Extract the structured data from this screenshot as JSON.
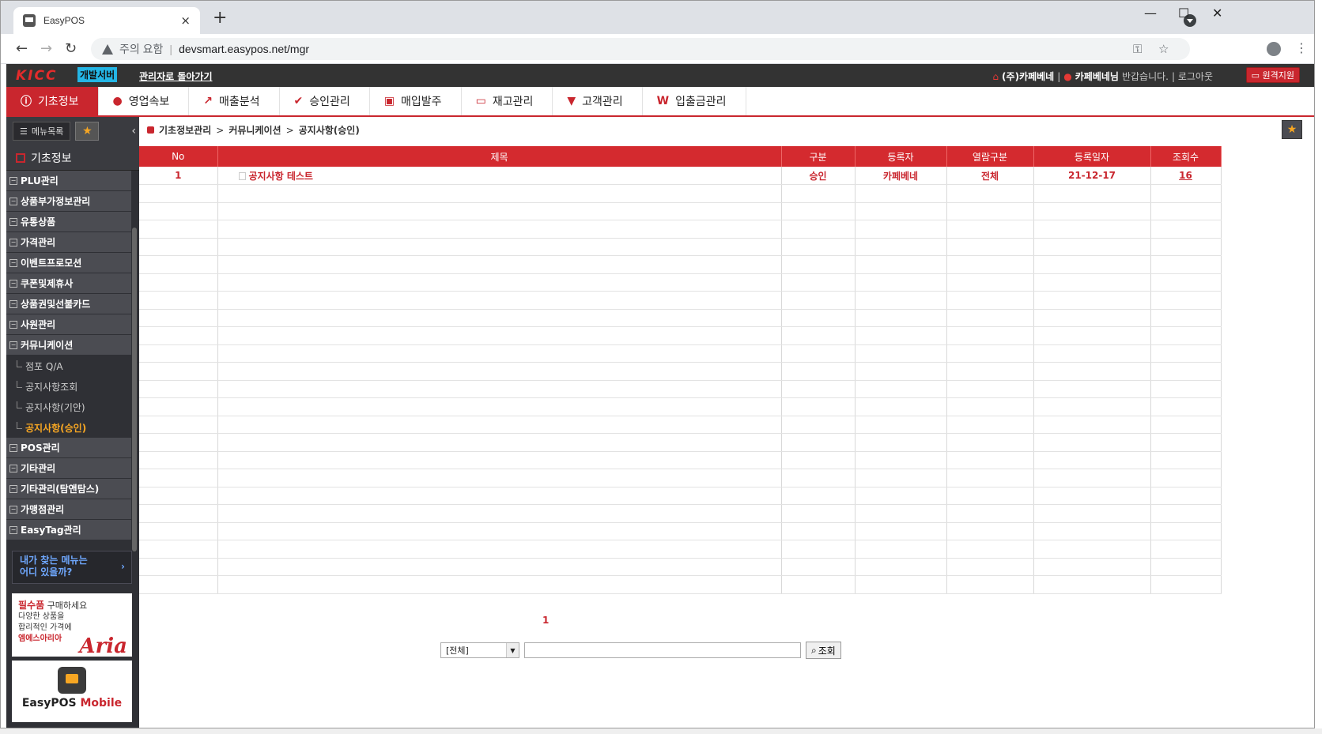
{
  "browser": {
    "tab_title": "EasyPOS",
    "tab_close": "×",
    "new_tab": "+",
    "window_controls": [
      "—",
      "☐",
      "✕"
    ],
    "security_label": "주의 요함",
    "separator": "|",
    "url": "devsmart.easypos.net/mgr"
  },
  "header": {
    "logo": "KICC",
    "dev_badge": "개발서버",
    "back_link": "관리자로 돌아가기",
    "company": "(주)카페베네",
    "divider": "|",
    "username": "카페베네님",
    "greeting": "반갑습니다.",
    "logout": "| 로그아웃",
    "remote_support": "원격지원"
  },
  "nav": {
    "items": [
      {
        "label": "기초정보",
        "icon": "info-icon",
        "glyph": "ⓘ"
      },
      {
        "label": "영업속보",
        "icon": "mic-icon",
        "glyph": "●"
      },
      {
        "label": "매출분석",
        "icon": "trend-icon",
        "glyph": "↗"
      },
      {
        "label": "승인관리",
        "icon": "check-icon",
        "glyph": "✔"
      },
      {
        "label": "매입발주",
        "icon": "order-icon",
        "glyph": "▣"
      },
      {
        "label": "재고관리",
        "icon": "monitor-icon",
        "glyph": "▭"
      },
      {
        "label": "고객관리",
        "icon": "tie-icon",
        "glyph": "▼"
      },
      {
        "label": "입출금관리",
        "icon": "won-icon",
        "glyph": "W"
      }
    ]
  },
  "sidebar": {
    "menu_button": "메뉴목록",
    "title": "기초정보",
    "items": [
      "PLU관리",
      "상품부가정보관리",
      "유통상품",
      "가격관리",
      "이벤트프로모션",
      "쿠폰및제휴사",
      "상품권및선불카드",
      "사원관리",
      "커뮤니케이션"
    ],
    "sub_items": [
      "점포 Q/A",
      "공지사항조회",
      "공지사항(기안)",
      "공지사항(승인)"
    ],
    "items_after": [
      "POS관리",
      "기타관리",
      "기타관리(탐앤탐스)",
      "가맹점관리",
      "EasyTag관리"
    ],
    "help_line1": "내가 찾는 메뉴는",
    "help_line2": "어디 있을까?",
    "ad1": {
      "head": "필수품",
      "head_rest": " 구매하세요",
      "line1": "다양한 상품을",
      "line2": "합리적인 가격에",
      "brand": "엠에스아리아",
      "logo": "Aria"
    },
    "ad2": {
      "app_label": "EasyPOS",
      "easy": "EasyPOS ",
      "mobile": "Mobile"
    }
  },
  "breadcrumb": {
    "level1": "기초정보관리",
    "level2": "커뮤니케이션",
    "level3": "공지사항(승인)",
    "sep": ">"
  },
  "table": {
    "columns": [
      "No",
      "제목",
      "구분",
      "등록자",
      "열람구분",
      "등록일자",
      "조회수"
    ],
    "rows": [
      {
        "no": "1",
        "title": "공지사항 테스트",
        "type": "승인",
        "author": "카페베네",
        "view": "전체",
        "date": "21-12-17",
        "count": "16"
      }
    ]
  },
  "pager": {
    "current": "1"
  },
  "search": {
    "select_value": "[전체]",
    "input_value": "",
    "button": "조회"
  },
  "colors": {
    "accent": "#c9262e",
    "header_bg": "#333333",
    "sidebar_bg": "#2f3035",
    "highlight": "#f6a623"
  }
}
